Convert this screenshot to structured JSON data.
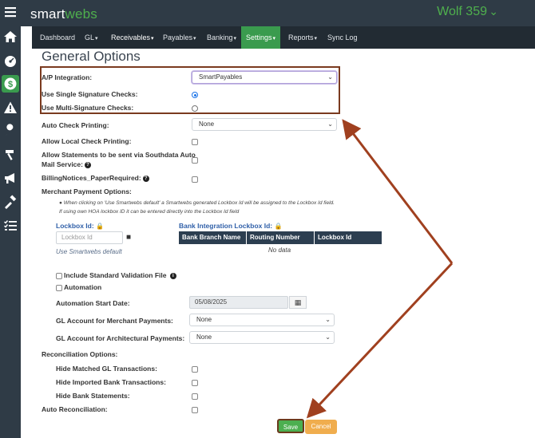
{
  "app": {
    "logo_main": "smart",
    "logo_accent": "webs",
    "tenant": "Wolf 359",
    "tenant_chevron": "⌄"
  },
  "sidebar": {
    "items": [
      {
        "icon": "menu-icon"
      },
      {
        "icon": "home-icon"
      },
      {
        "icon": "dashboard-gauge-icon"
      },
      {
        "icon": "dollar-icon",
        "active": true
      },
      {
        "icon": "warning-icon"
      },
      {
        "icon": "wrench-icon"
      },
      {
        "icon": "hammer-icon"
      },
      {
        "icon": "megaphone-icon"
      },
      {
        "icon": "tools-icon"
      },
      {
        "icon": "checklist-icon"
      }
    ]
  },
  "nav": {
    "items": [
      {
        "label": "Dashboard",
        "caret": ""
      },
      {
        "label": "GL",
        "caret": "▾"
      },
      {
        "label": "Receivables",
        "caret": "▾"
      },
      {
        "label": "Payables",
        "caret": "▾"
      },
      {
        "label": "Banking",
        "caret": "▾"
      },
      {
        "label": "Settings",
        "caret": "▾",
        "active": true
      },
      {
        "label": "Reports",
        "caret": "▾"
      },
      {
        "label": "Sync Log",
        "caret": ""
      }
    ]
  },
  "page": {
    "title": "General Options"
  },
  "form": {
    "ap_integration_label": "A/P Integration:",
    "ap_integration_value": "SmartPayables",
    "single_sig_label": "Use Single Signature Checks:",
    "multi_sig_label": "Use Multi-Signature Checks:",
    "auto_check_label": "Auto Check Printing:",
    "auto_check_value": "None",
    "allow_local_label": "Allow Local Check Printing:",
    "allow_statements_label_1": "Allow Statements to be sent via Southdata Auto",
    "allow_statements_label_2": "Mail Service:",
    "billing_notices_label": "BillingNotices_PaperRequired:",
    "merchant_payment_label": "Merchant Payment Options:",
    "note_1": "When clicking on 'Use Smartwebs default' a Smartwebs generated Lockbox Id will be assigned to the Lockbox Id field.",
    "note_2": "If using own HOA lockbox ID it can be entered directly into the Lockbox Id field",
    "lockbox_id_label": "Lockbox Id:",
    "lockbox_placeholder": "Lockbox Id",
    "use_default_link": "Use Smartwebs default",
    "bank_integration_label": "Bank Integration Lockbox Id:",
    "grid_headers": [
      "Bank Branch Name",
      "Routing Number",
      "Lockbox Id"
    ],
    "no_data": "No data",
    "include_validation_label": "Include Standard Validation File",
    "automation_label": "Automation",
    "automation_start_label": "Automation Start Date:",
    "automation_start_value": "05/08/2025",
    "gl_merchant_label": "GL Account for Merchant Payments:",
    "gl_merchant_value": "None",
    "gl_arch_label": "GL Account for Architectural Payments:",
    "gl_arch_value": "None",
    "reconciliation_label": "Reconciliation Options:",
    "hide_matched_label": "Hide Matched GL Transactions:",
    "hide_imported_label": "Hide Imported Bank Transactions:",
    "hide_statements_label": "Hide Bank Statements:",
    "auto_reconciliation_label": "Auto Reconciliation:",
    "help_glyph": "?"
  },
  "buttons": {
    "save": "Save",
    "cancel": "Cancel"
  },
  "annotation": {
    "highlight_color": "#7a3a1f",
    "arrow_color": "#a0401f"
  }
}
